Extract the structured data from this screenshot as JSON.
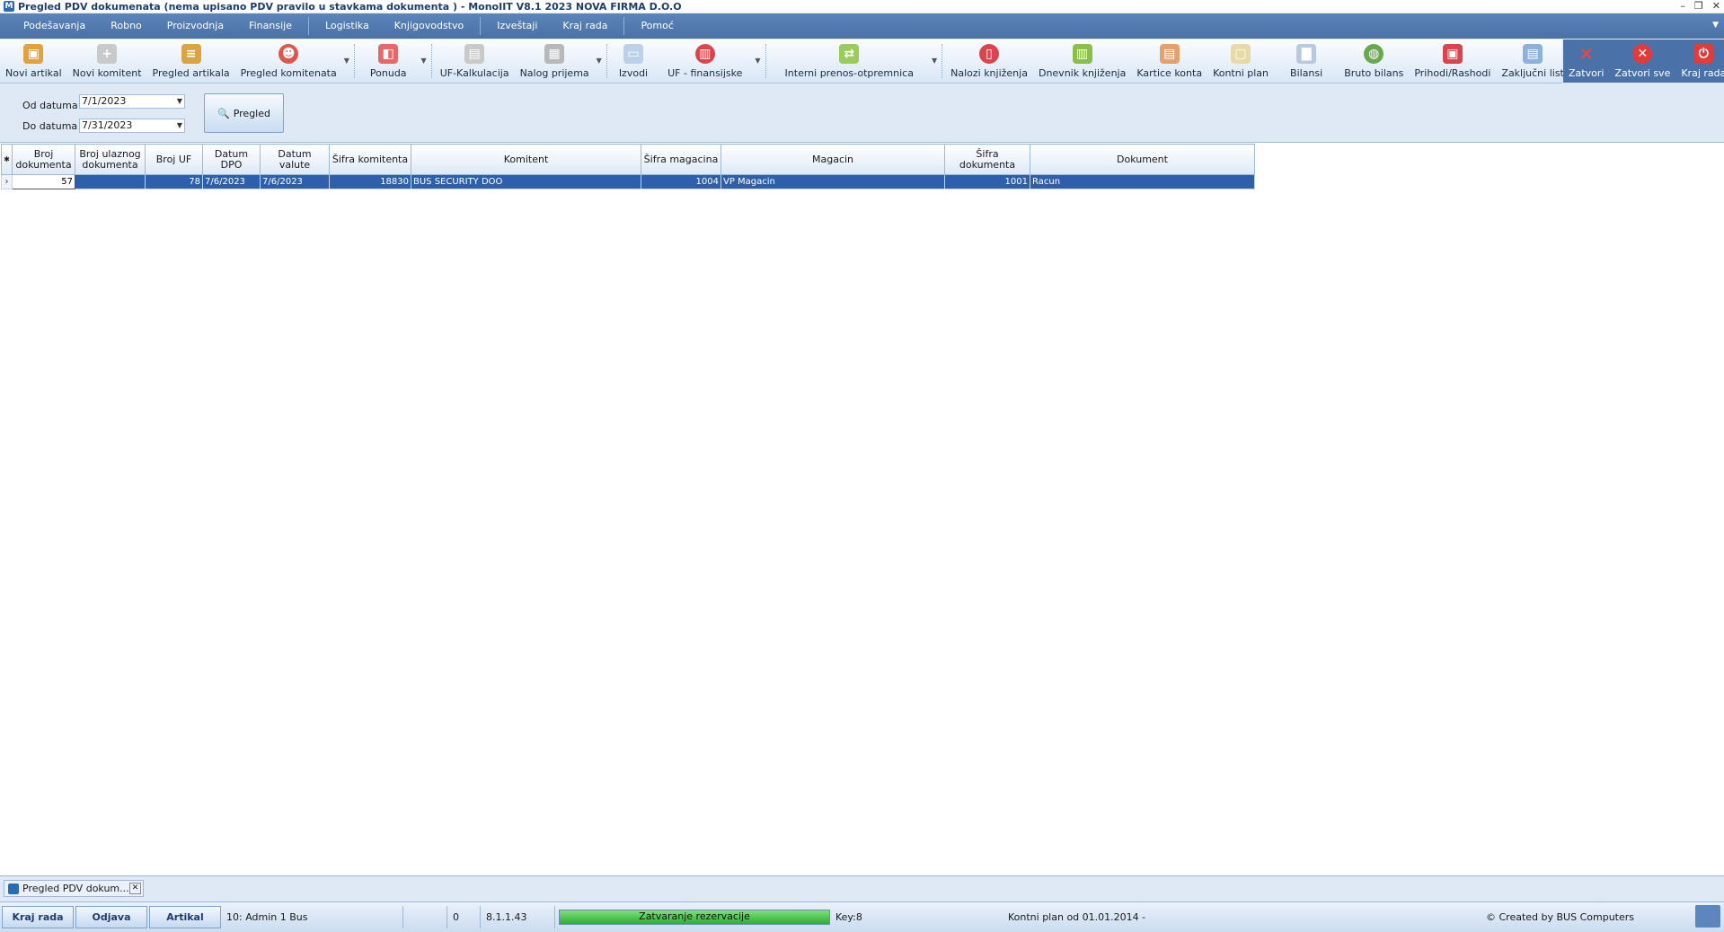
{
  "window": {
    "title": "Pregled PDV dokumenata (nema upisano PDV pravilo u stavkama dokumenta ) - MonoIIT V8.1 2023 NOVA FIRMA D.O.O",
    "controls": [
      "–",
      "❐",
      "✕"
    ]
  },
  "menu": [
    "Podešavanja",
    "Robno",
    "Proizvodnja",
    "Finansije",
    "Logistika",
    "Knjigovodstvo",
    "Izveštaji",
    "Kraj rada",
    "Pomoć"
  ],
  "toolbar": {
    "buttons": [
      {
        "label": "Novi artikal",
        "icon": "box-icon",
        "color": "#e0a23a"
      },
      {
        "label": "Novi komitent",
        "icon": "user-add-icon",
        "color": "#c9c9c9"
      },
      {
        "label": "Pregled artikala",
        "icon": "items-list-icon",
        "color": "#d9a441"
      },
      {
        "label": "Pregled komitenata",
        "icon": "clients-icon",
        "color": "#e0544a"
      },
      {
        "label": "Ponuda",
        "icon": "offer-icon",
        "color": "#e46a6a"
      },
      {
        "label": "UF-Kalkulacija",
        "icon": "calculation-icon",
        "color": "#c9c9c9"
      },
      {
        "label": "Nalog prijema",
        "icon": "receipt-order-icon",
        "color": "#b8b8b8"
      },
      {
        "label": "Izvodi",
        "icon": "statements-icon",
        "color": "#bcd0e8"
      },
      {
        "label": "UF - finansijske",
        "icon": "finance-icon",
        "color": "#d8454d"
      },
      {
        "label": "Interni prenos-otpremnica",
        "icon": "transfer-icon",
        "color": "#9acb5b"
      },
      {
        "label": "Nalozi knjiženja",
        "icon": "posting-orders-icon",
        "color": "#d8454d"
      },
      {
        "label": "Dnevnik knjiženja",
        "icon": "journal-icon",
        "color": "#8cbf4a"
      },
      {
        "label": "Kartice konta",
        "icon": "account-cards-icon",
        "color": "#e6a06a"
      },
      {
        "label": "Kontni plan",
        "icon": "chart-of-accounts-icon",
        "color": "#e8d9a8"
      },
      {
        "label": "Bilansi",
        "icon": "balance-icon",
        "color": "#b9c8dc"
      },
      {
        "label": "Bruto bilans",
        "icon": "globe-icon",
        "color": "#6aa84f"
      },
      {
        "label": "Prihodi/Rashodi",
        "icon": "income-expense-icon",
        "color": "#d8454d"
      },
      {
        "label": "Zaključni list",
        "icon": "final-sheet-icon",
        "color": "#8fb0d8"
      }
    ],
    "right_buttons": [
      {
        "label": "Zatvori",
        "icon": "close-icon",
        "color": "#e03c3c"
      },
      {
        "label": "Zatvori sve",
        "icon": "close-all-icon",
        "color": "#e03c3c"
      },
      {
        "label": "Kraj rada",
        "icon": "power-icon",
        "color": "#e03c3c"
      }
    ]
  },
  "filter": {
    "od_label": "Od datuma",
    "od_value": "7/1/2023",
    "do_label": "Do datuma",
    "do_value": "7/31/2023",
    "button_label": "Pregled"
  },
  "grid": {
    "columns": [
      "Broj dokumenta",
      "Broj ulaznog dokumenta",
      "Broj UF",
      "Datum DPO",
      "Datum valute",
      "Šifra komitenta",
      "Komitent",
      "Šifra magacina",
      "Magacin",
      "Šifra dokumenta",
      "Dokument"
    ],
    "rows": [
      [
        "57",
        "",
        "78",
        "7/6/2023",
        "7/6/2023",
        "18830",
        "BUS SECURITY DOO",
        "1004",
        "VP Magacin",
        "1001",
        "Racun"
      ]
    ]
  },
  "tabs": [
    {
      "label": "Pregled PDV dokum..."
    }
  ],
  "status": {
    "btn1": "Kraj rada",
    "btn2": "Odjava",
    "btn3": "Artikal",
    "user": "10: Admin 1 Bus",
    "count": "0",
    "version": "8.1.1.43",
    "progress_label": "Zatvaranje rezervacije",
    "progress_fraction": 1.0,
    "key": "Key:8",
    "plan": "Kontni plan od 01.01.2014 -",
    "copyright": "© Created by BUS Computers"
  }
}
